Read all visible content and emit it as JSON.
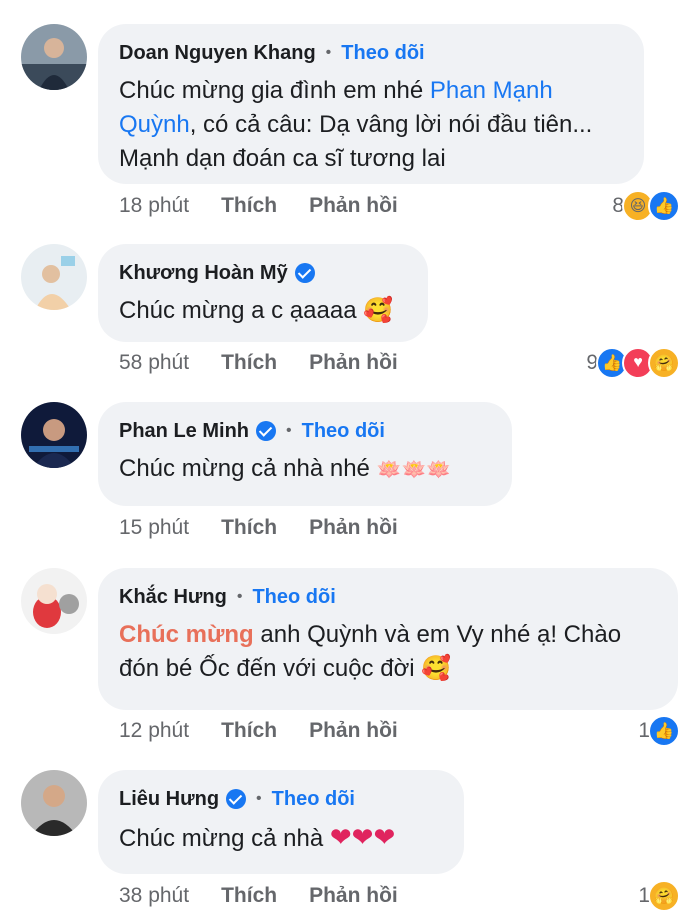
{
  "comments": [
    {
      "name": "Doan Nguyen Khang",
      "verified": false,
      "follow": "Theo dõi",
      "text_parts": [
        "Chúc mừng gia đình em nhé ",
        "Phan Mạnh Quỳnh",
        ", có cả câu: Dạ vâng lời nói đầu tiên... Mạnh dạn đoán ca sĩ tương lai"
      ],
      "time": "18 phút",
      "like": "Thích",
      "reply": "Phản hồi",
      "reaction_count": "8",
      "reactions": [
        "haha-icon",
        "like-icon"
      ]
    },
    {
      "name": "Khương Hoàn Mỹ",
      "verified": true,
      "follow": "",
      "text": "Chúc mừng a c ạaaaa",
      "time": "58 phút",
      "like": "Thích",
      "reply": "Phản hồi",
      "reaction_count": "9",
      "reactions": [
        "like-icon",
        "love-icon",
        "care-icon"
      ]
    },
    {
      "name": "Phan Le Minh",
      "verified": true,
      "follow": "Theo dõi",
      "text": "Chúc mừng cả nhà nhé",
      "time": "15 phút",
      "like": "Thích",
      "reply": "Phản hồi",
      "reaction_count": "",
      "reactions": []
    },
    {
      "name": "Khắc Hưng",
      "verified": false,
      "follow": "Theo dõi",
      "text_highlight": "Chúc mừng",
      "text_rest": " anh Quỳnh và em Vy nhé ạ! Chào đón bé Ốc đến với cuộc đời",
      "time": "12 phút",
      "like": "Thích",
      "reply": "Phản hồi",
      "reaction_count": "1",
      "reactions": [
        "like-icon"
      ]
    },
    {
      "name": "Liêu Hưng",
      "verified": true,
      "follow": "Theo dõi",
      "text": "Chúc mừng cả nhà",
      "time": "38 phút",
      "like": "Thích",
      "reply": "Phản hồi",
      "reaction_count": "1",
      "reactions": [
        "care-icon"
      ]
    }
  ],
  "colors": {
    "accent": "#1877f2",
    "bubble": "#f0f2f5",
    "meta": "#65676b",
    "highlight": "#e8705a"
  }
}
